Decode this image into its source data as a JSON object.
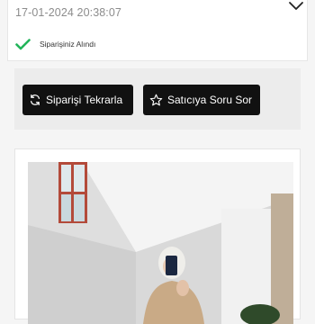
{
  "order": {
    "date": "17-01-2024 20:38:07",
    "status_text": "Siparişiniz Alındı"
  },
  "actions": {
    "reorder_label": "Siparişi Tekrarla",
    "ask_seller_label": "Satıcıya Soru Sor"
  },
  "icons": {
    "expand": "chevron-down-icon",
    "status": "check-icon",
    "reorder": "refresh-icon",
    "ask": "star-icon"
  },
  "colors": {
    "check_green": "#22b45a",
    "button_bg": "#111111",
    "date_text": "#8c8c8c"
  }
}
